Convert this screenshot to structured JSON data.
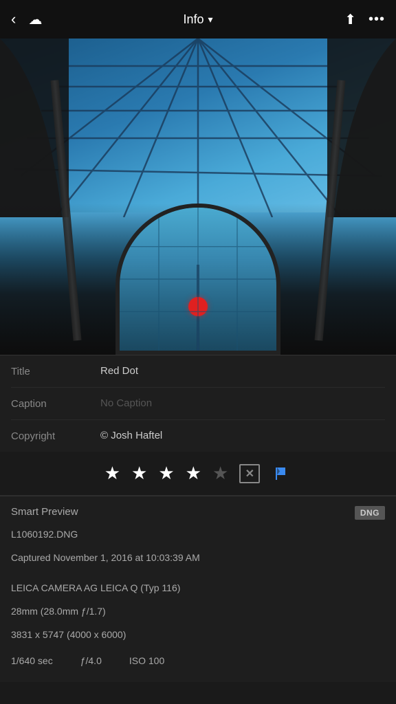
{
  "header": {
    "back_label": "‹",
    "cloud_icon": "☁",
    "title": "Info",
    "chevron": "▾",
    "share_icon": "⬆",
    "more_icon": "•••"
  },
  "photo": {
    "alt": "Architectural glass ceiling with red dot"
  },
  "metadata": {
    "title_label": "Title",
    "title_value": "Red Dot",
    "caption_label": "Caption",
    "caption_value": "No Caption",
    "copyright_label": "Copyright",
    "copyright_value": "© Josh Haftel"
  },
  "rating": {
    "stars_filled": 4,
    "stars_empty": 1,
    "total": 5
  },
  "details": {
    "smart_preview_label": "Smart Preview",
    "dng_badge": "DNG",
    "filename": "L1060192.DNG",
    "captured": "Captured November 1, 2016 at 10:03:39 AM",
    "camera": "LEICA CAMERA AG LEICA Q (Typ 116)",
    "focal_length": "28mm (28.0mm ƒ/1.7)",
    "dimensions": "3831 x 5747 (4000 x 6000)",
    "shutter": "1/640 sec",
    "aperture": "ƒ/4.0",
    "iso": "ISO 100"
  }
}
